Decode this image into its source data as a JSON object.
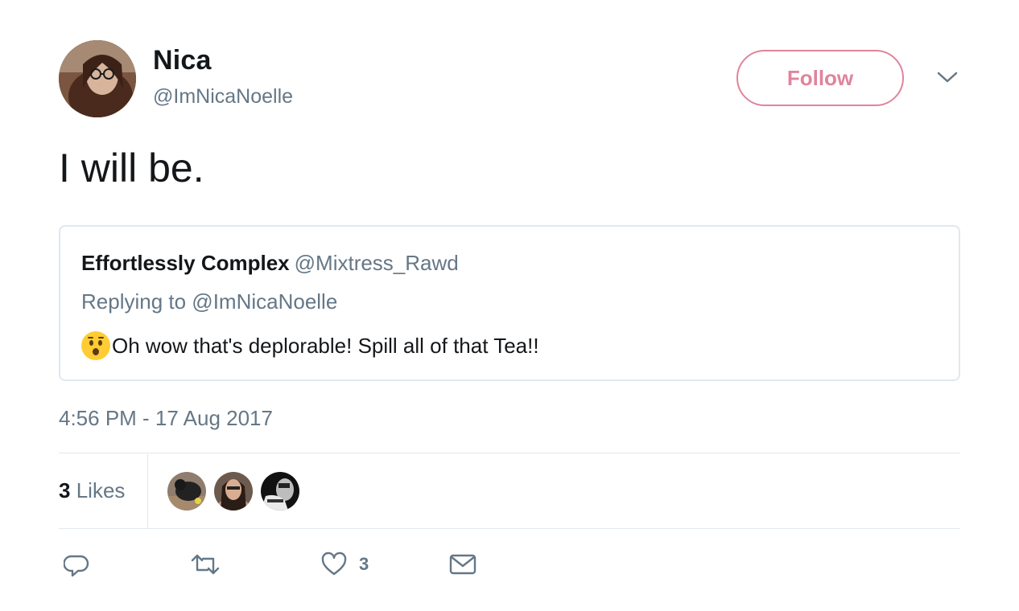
{
  "author": {
    "name": "Nica",
    "handle": "@ImNicaNoelle"
  },
  "follow_label": "Follow",
  "colors": {
    "accent_pink": "#e0849c",
    "secondary_text": "#657786",
    "border": "#e1e8ed"
  },
  "tweet": {
    "text": "I will be."
  },
  "quoted_tweet": {
    "name": "Effortlessly Complex",
    "handle": "@Mixtress_Rawd",
    "replying_to": "Replying to @ImNicaNoelle",
    "emoji": "hushed-face-emoji",
    "text": "Oh wow that's deplorable! Spill all of that Tea!!"
  },
  "timestamp": "4:56 PM - 17 Aug 2017",
  "likes": {
    "count": "3",
    "label": "Likes",
    "liker_count": 3
  },
  "actions": {
    "reply_icon": "reply-icon",
    "retweet_icon": "retweet-icon",
    "like_icon": "heart-icon",
    "like_count": "3",
    "dm_icon": "envelope-icon"
  }
}
